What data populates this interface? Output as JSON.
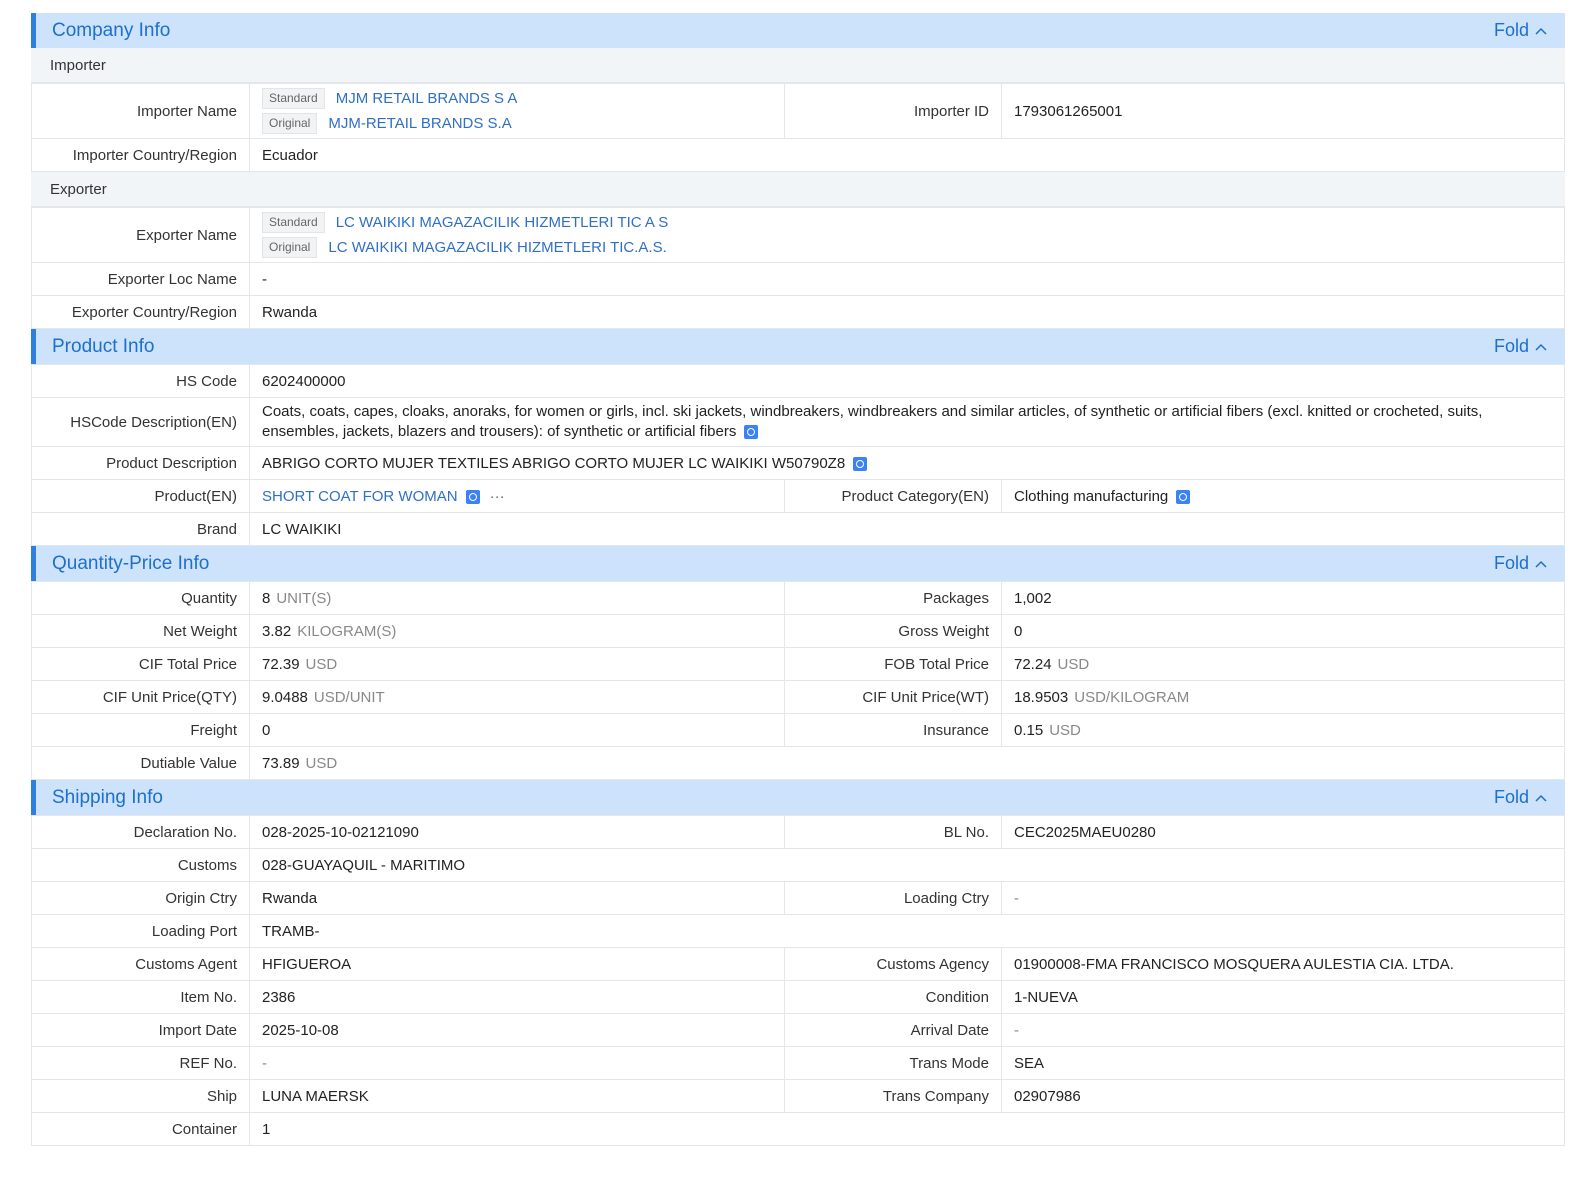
{
  "fold_label": "Fold",
  "company": {
    "title": "Company Info",
    "importer_heading": "Importer",
    "importer_name_label": "Importer Name",
    "standard_tag": "Standard",
    "original_tag": "Original",
    "importer_name_standard": "MJM RETAIL BRANDS S A",
    "importer_name_original": "MJM-RETAIL BRANDS S.A",
    "importer_id_label": "Importer ID",
    "importer_id": "1793061265001",
    "importer_country_label": "Importer Country/Region",
    "importer_country": "Ecuador",
    "exporter_heading": "Exporter",
    "exporter_name_label": "Exporter Name",
    "exporter_name_standard": "LC WAIKIKI MAGAZACILIK HIZMETLERI TIC A S",
    "exporter_name_original": "LC WAIKIKI MAGAZACILIK HIZMETLERI TIC.A.S.",
    "exporter_loc_label": "Exporter Loc Name",
    "exporter_loc": "-",
    "exporter_country_label": "Exporter Country/Region",
    "exporter_country": "Rwanda"
  },
  "product": {
    "title": "Product Info",
    "hs_code_label": "HS Code",
    "hs_code": "6202400000",
    "hs_desc_label": "HSCode Description(EN)",
    "hs_desc": "Coats, coats, capes, cloaks, anoraks, for women or girls, incl. ski jackets, windbreakers, windbreakers and similar articles, of synthetic or artificial fibers (excl. knitted or crocheted, suits, ensembles, jackets, blazers and trousers): of synthetic or artificial fibers",
    "product_desc_label": "Product Description",
    "product_desc": "ABRIGO CORTO MUJER TEXTILES ABRIGO CORTO MUJER LC WAIKIKI W50790Z8",
    "product_en_label": "Product(EN)",
    "product_en": "SHORT COAT FOR WOMAN",
    "more_label": "···",
    "category_label": "Product Category(EN)",
    "category": "Clothing manufacturing",
    "brand_label": "Brand",
    "brand": "LC WAIKIKI"
  },
  "quantity": {
    "title": "Quantity-Price Info",
    "quantity_label": "Quantity",
    "quantity": "8",
    "quantity_unit": "UNIT(S)",
    "packages_label": "Packages",
    "packages": "1,002",
    "net_weight_label": "Net Weight",
    "net_weight": "3.82",
    "net_weight_unit": "KILOGRAM(S)",
    "gross_weight_label": "Gross Weight",
    "gross_weight": "0",
    "cif_total_label": "CIF Total Price",
    "cif_total": "72.39",
    "cif_total_unit": "USD",
    "fob_total_label": "FOB Total Price",
    "fob_total": "72.24",
    "fob_total_unit": "USD",
    "cif_unit_qty_label": "CIF Unit Price(QTY)",
    "cif_unit_qty": "9.0488",
    "cif_unit_qty_unit": "USD/UNIT",
    "cif_unit_wt_label": "CIF Unit Price(WT)",
    "cif_unit_wt": "18.9503",
    "cif_unit_wt_unit": "USD/KILOGRAM",
    "freight_label": "Freight",
    "freight": "0",
    "insurance_label": "Insurance",
    "insurance": "0.15",
    "insurance_unit": "USD",
    "dutiable_label": "Dutiable Value",
    "dutiable": "73.89",
    "dutiable_unit": "USD"
  },
  "shipping": {
    "title": "Shipping Info",
    "declaration_label": "Declaration No.",
    "declaration": "028-2025-10-02121090",
    "bl_label": "BL No.",
    "bl": "CEC2025MAEU0280",
    "customs_label": "Customs",
    "customs": "028-GUAYAQUIL - MARITIMO",
    "origin_label": "Origin Ctry",
    "origin": "Rwanda",
    "loading_ctry_label": "Loading Ctry",
    "loading_ctry": "-",
    "loading_port_label": "Loading Port",
    "loading_port": "TRAMB-",
    "agent_label": "Customs Agent",
    "agent": "HFIGUEROA",
    "agency_label": "Customs Agency",
    "agency": "01900008-FMA FRANCISCO MOSQUERA AULESTIA CIA. LTDA.",
    "item_label": "Item No.",
    "item": "2386",
    "condition_label": "Condition",
    "condition": "1-NUEVA",
    "import_date_label": "Import Date",
    "import_date": "2025-10-08",
    "arrival_label": "Arrival Date",
    "arrival": "-",
    "ref_label": "REF No.",
    "ref": "-",
    "trans_mode_label": "Trans Mode",
    "trans_mode": "SEA",
    "ship_label": "Ship",
    "ship": "LUNA MAERSK",
    "trans_company_label": "Trans Company",
    "trans_company": "02907986",
    "container_label": "Container",
    "container": "1"
  }
}
